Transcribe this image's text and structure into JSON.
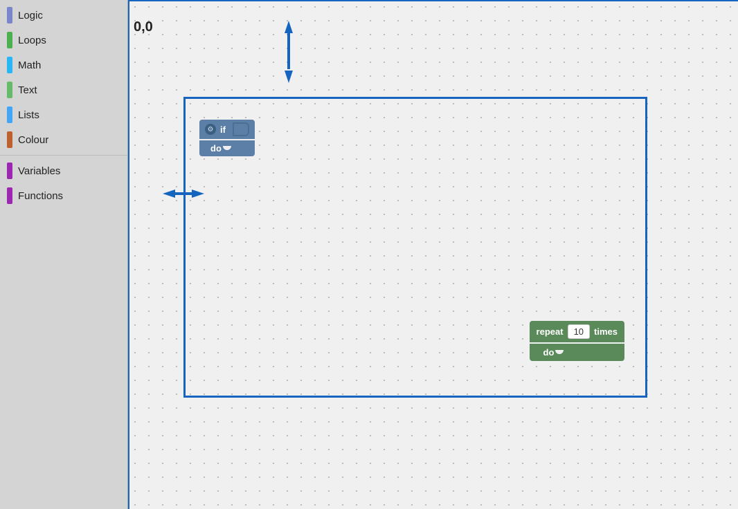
{
  "sidebar": {
    "items": [
      {
        "id": "logic",
        "label": "Logic",
        "color": "#7986cb"
      },
      {
        "id": "loops",
        "label": "Loops",
        "color": "#4caf50"
      },
      {
        "id": "math",
        "label": "Math",
        "color": "#29b6f6"
      },
      {
        "id": "text",
        "label": "Text",
        "color": "#66bb6a"
      },
      {
        "id": "lists",
        "label": "Lists",
        "color": "#42a5f5"
      },
      {
        "id": "colour",
        "label": "Colour",
        "color": "#bf6030"
      }
    ],
    "items2": [
      {
        "id": "variables",
        "label": "Variables",
        "color": "#9c27b0"
      },
      {
        "id": "functions",
        "label": "Functions",
        "color": "#9c27b0"
      }
    ]
  },
  "workspace": {
    "coord_label": "0,0",
    "if_block": {
      "if_label": "if",
      "do_label": "do"
    },
    "repeat_block": {
      "repeat_label": "repeat",
      "count": "10",
      "times_label": "times",
      "do_label": "do"
    }
  }
}
